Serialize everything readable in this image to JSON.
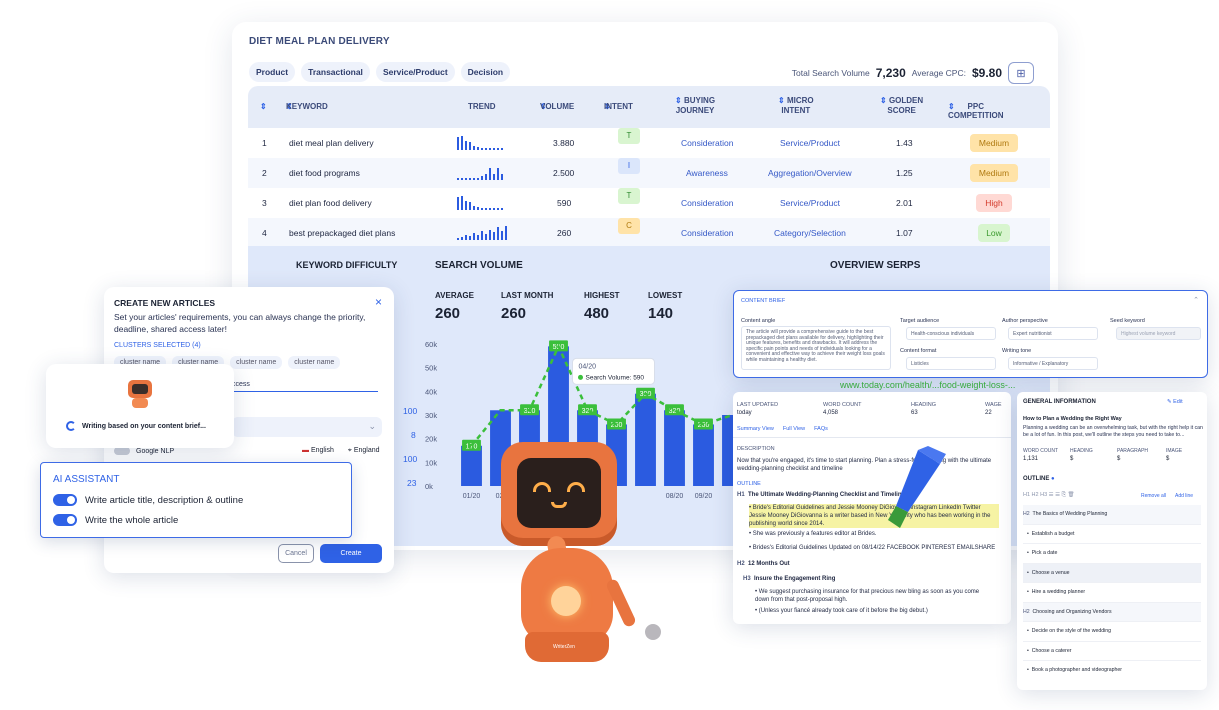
{
  "main": {
    "title": "DIET MEAL PLAN DELIVERY",
    "chips": [
      "Product",
      "Transactional",
      "Service/Product",
      "Decision"
    ],
    "total_label": "Total Search Volume",
    "total_value": "7,230",
    "cpc_label": "Average CPC:",
    "cpc_value": "$9.80",
    "columns": {
      "keyword": "KEYWORD",
      "trend": "TREND",
      "volume": "VOLUME",
      "intent": "INTENT",
      "buying1": "BUYING",
      "buying2": "JOURNEY",
      "micro1": "MICRO",
      "micro2": "INTENT",
      "golden1": "GOLDEN",
      "golden2": "SCORE",
      "ppc": "PPC COMPETITION"
    },
    "rows": [
      {
        "n": "1",
        "keyword": "diet meal plan delivery",
        "volume": "3.880",
        "intent": "T",
        "journey": "Consideration",
        "micro": "Service/Product",
        "score": "1.43",
        "comp": "Medium"
      },
      {
        "n": "2",
        "keyword": "diet food programs",
        "volume": "2.500",
        "intent": "I",
        "journey": "Awareness",
        "micro": "Aggregation/Overview",
        "score": "1.25",
        "comp": "Medium"
      },
      {
        "n": "3",
        "keyword": "diet plan food delivery",
        "volume": "590",
        "intent": "T",
        "journey": "Consideration",
        "micro": "Service/Product",
        "score": "2.01",
        "comp": "High"
      },
      {
        "n": "4",
        "keyword": "best prepackaged diet plans",
        "volume": "260",
        "intent": "C",
        "journey": "Consideration",
        "micro": "Category/Selection",
        "score": "1.07",
        "comp": "Low"
      }
    ],
    "colors": {
      "medium_bg": "#ffe3a8",
      "high_bg": "#ffd9d4",
      "low_bg": "#d8f5cf",
      "accent": "#2f62e6"
    }
  },
  "lower": {
    "kd_title": "KEYWORD DIFFICULTY",
    "sv_title": "SEARCH VOLUME",
    "serps_title": "OVERVIEW SERPS",
    "stats": [
      {
        "label": "AVERAGE",
        "value": "260"
      },
      {
        "label": "LAST MONTH",
        "value": "260"
      },
      {
        "label": "HIGHEST",
        "value": "480"
      },
      {
        "label": "LOWEST",
        "value": "140"
      }
    ],
    "side_numbers": [
      "100",
      "8",
      "100",
      "23"
    ],
    "url": "www.today.com/health/...food-weight-loss-..."
  },
  "chart_data": {
    "type": "bar",
    "categories": [
      "01/20",
      "02/",
      "",
      "",
      "",
      "",
      "",
      "08/20",
      "09/20",
      ""
    ],
    "values": [
      170,
      320,
      320,
      590,
      320,
      260,
      390,
      320,
      260,
      300
    ],
    "labels": [
      "170",
      "",
      "320",
      "590",
      "320",
      "260",
      "390",
      "320",
      "260",
      ""
    ],
    "y_ticks": [
      "60k",
      "50k",
      "40k",
      "30k",
      "20k",
      "10k",
      "0k"
    ],
    "ylim": [
      0,
      600
    ],
    "tooltip": {
      "date": "04/20",
      "label": "Search Volume:",
      "value": "590"
    }
  },
  "create": {
    "title": "CREATE NEW ARTICLES",
    "desc": "Set your articles' requirements, you can always change the priority, deadline, shared access later!",
    "clusters_label": "CLUSTERS SELECTED (4)",
    "clusters": [
      "cluster name",
      "cluster name",
      "cluster name",
      "cluster name"
    ],
    "access": "ccess",
    "google_nlp": "Google NLP",
    "lang": "English",
    "region": "England",
    "cancel": "Cancel",
    "create": "Create"
  },
  "writing": {
    "text": "Writing based on your content brief..."
  },
  "ai": {
    "title": "AI ASSISTANT",
    "opt1": "Write article title, description & outline",
    "opt2": "Write the whole article"
  },
  "brief": {
    "title": "CONTENT BRIEF",
    "angle_label": "Content angle",
    "angle_text": "The article will provide a comprehensive guide to the best prepackaged diet plans available for delivery, highlighting their unique features, benefits and drawbacks. It will address the specific pain points and needs of individuals looking for a convenient and effective way to achieve their weight loss goals while maintaining a healthy diet.",
    "audience_label": "Target audience",
    "audience_value": "Health-conscious individuals",
    "author_label": "Author perspective",
    "author_value": "Expert nutritionist",
    "seed_label": "Seed keyword",
    "seed_value": "Highest volume keyword",
    "format_label": "Content format",
    "format_value": "Listicles",
    "tone_label": "Writing tone",
    "tone_value": "Informative / Explanatory"
  },
  "article": {
    "last_updated_label": "LAST UPDATED",
    "last_updated": "today",
    "word_count_label": "WORD COUNT",
    "word_count": "4,058",
    "heading_label": "HEADING",
    "heading": "63",
    "wage_label": "WAGE",
    "wage": "22",
    "tabs": [
      "Summary View",
      "Full View",
      "FAQs"
    ],
    "desc_label": "DESCRIPTION",
    "desc": "Now that you're engaged, it's time to start planning. Plan a stress-free planning with the ultimate wedding-planning checklist and timeline",
    "outline_label": "OUTLINE",
    "h1": "The Ultimate Wedding-Planning Checklist and Timeline",
    "b1": "Bride's Editorial Guidelines and Jessie Mooney DiGiovanni Instagram LinkedIn Twitter Jessie Mooney DiGiovanna is a writer based in New York City who has been working in the publishing world since 2014.",
    "b2": "She was previously a features editor at Brides.",
    "b3": "Brides's Editorial Guidelines Updated on 08/14/22 FACEBOOK PINTEREST EMAILSHARE",
    "h2": "12 Months Out",
    "h3": "Insure the Engagement Ring",
    "b4": "We suggest purchasing insurance for that precious new bling as soon as you come down from that post-proposal high.",
    "b5": "(Unless your fiancé already took care of it before the big debut.)"
  },
  "general": {
    "title": "GENERAL INFORMATION",
    "edit": "Edit",
    "article_title": "How to Plan a Wedding the Right Way",
    "article_desc": "Planning a wedding can be an overwhelming task, but with the right help it can be a lot of fun. In this post, we'll outline the steps you need to take to...",
    "word_count_label": "WORD COUNT",
    "word_count": "1,131",
    "heading_label": "HEADING",
    "heading": "$",
    "paragraph_label": "PARAGRAPH",
    "paragraph": "$",
    "image_label": "IMAGE",
    "image": "$",
    "outline_label": "OUTLINE",
    "remove_all": "Remove all",
    "add_line": "Add line",
    "items": [
      {
        "tag": "H2",
        "text": "The Basics of Wedding Planning"
      },
      {
        "tag": "•",
        "text": "Establish a budget"
      },
      {
        "tag": "•",
        "text": "Pick a date"
      },
      {
        "tag": "•",
        "text": "Choose a venue"
      },
      {
        "tag": "•",
        "text": "Hire a wedding planner"
      },
      {
        "tag": "H2",
        "text": "Choosing and Organizing Vendors"
      },
      {
        "tag": "•",
        "text": "Decide on the style of the wedding"
      },
      {
        "tag": "•",
        "text": "Choose a caterer"
      },
      {
        "tag": "•",
        "text": "Book a photographer and videographer"
      }
    ]
  },
  "robot": {
    "brand": "WriterZen"
  }
}
